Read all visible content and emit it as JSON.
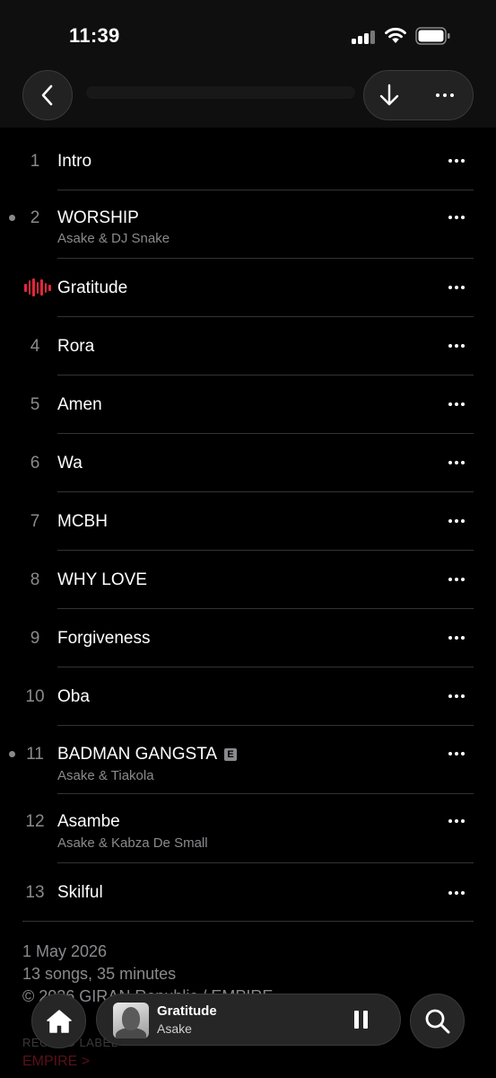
{
  "status_bar": {
    "time": "11:39"
  },
  "tracks": [
    {
      "number": "1",
      "title": "Intro",
      "artist": "",
      "explicit": false,
      "playing": false,
      "dot": false
    },
    {
      "number": "2",
      "title": "WORSHIP",
      "artist": "Asake & DJ Snake",
      "explicit": false,
      "playing": false,
      "dot": true
    },
    {
      "number": "",
      "title": "Gratitude",
      "artist": "",
      "explicit": false,
      "playing": true,
      "dot": false
    },
    {
      "number": "4",
      "title": "Rora",
      "artist": "",
      "explicit": false,
      "playing": false,
      "dot": false
    },
    {
      "number": "5",
      "title": "Amen",
      "artist": "",
      "explicit": false,
      "playing": false,
      "dot": false
    },
    {
      "number": "6",
      "title": "Wa",
      "artist": "",
      "explicit": false,
      "playing": false,
      "dot": false
    },
    {
      "number": "7",
      "title": "MCBH",
      "artist": "",
      "explicit": false,
      "playing": false,
      "dot": false
    },
    {
      "number": "8",
      "title": "WHY LOVE",
      "artist": "",
      "explicit": false,
      "playing": false,
      "dot": false
    },
    {
      "number": "9",
      "title": "Forgiveness",
      "artist": "",
      "explicit": false,
      "playing": false,
      "dot": false
    },
    {
      "number": "10",
      "title": "Oba",
      "artist": "",
      "explicit": false,
      "playing": false,
      "dot": false
    },
    {
      "number": "11",
      "title": "BADMAN GANGSTA",
      "artist": "Asake & Tiakola",
      "explicit": true,
      "playing": false,
      "dot": true
    },
    {
      "number": "12",
      "title": "Asambe",
      "artist": "Asake & Kabza De Small",
      "explicit": false,
      "playing": false,
      "dot": false
    },
    {
      "number": "13",
      "title": "Skilful",
      "artist": "",
      "explicit": false,
      "playing": false,
      "dot": false
    }
  ],
  "explicit_badge": "E",
  "footer": {
    "release_date": "1 May 2026",
    "summary": "13 songs, 35 minutes",
    "copyright": "© 2026 GIRAN Republic / EMPIRE",
    "record_label_caption": "RECORD LABEL",
    "record_label": "EMPIRE >"
  },
  "now_playing": {
    "title": "Gratitude",
    "artist": "Asake"
  },
  "icons": {
    "back": "chevron-left-icon",
    "download": "arrow-down-icon",
    "more": "ellipsis-icon",
    "home": "home-icon",
    "pause": "pause-icon",
    "search": "search-icon"
  },
  "colors": {
    "accent": "#e0263a",
    "background": "#000000",
    "secondary_text": "#8a8a8e"
  }
}
